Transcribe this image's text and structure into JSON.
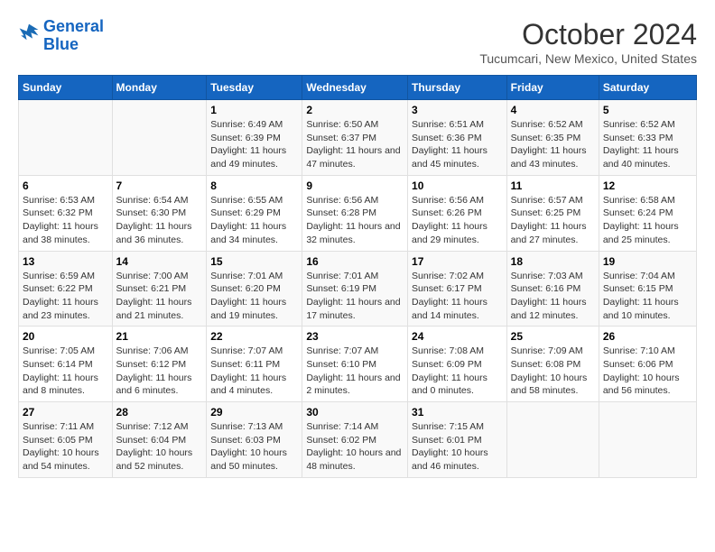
{
  "logo": {
    "line1": "General",
    "line2": "Blue"
  },
  "title": "October 2024",
  "subtitle": "Tucumcari, New Mexico, United States",
  "weekdays": [
    "Sunday",
    "Monday",
    "Tuesday",
    "Wednesday",
    "Thursday",
    "Friday",
    "Saturday"
  ],
  "weeks": [
    [
      {
        "day": "",
        "info": ""
      },
      {
        "day": "",
        "info": ""
      },
      {
        "day": "1",
        "info": "Sunrise: 6:49 AM\nSunset: 6:39 PM\nDaylight: 11 hours and 49 minutes."
      },
      {
        "day": "2",
        "info": "Sunrise: 6:50 AM\nSunset: 6:37 PM\nDaylight: 11 hours and 47 minutes."
      },
      {
        "day": "3",
        "info": "Sunrise: 6:51 AM\nSunset: 6:36 PM\nDaylight: 11 hours and 45 minutes."
      },
      {
        "day": "4",
        "info": "Sunrise: 6:52 AM\nSunset: 6:35 PM\nDaylight: 11 hours and 43 minutes."
      },
      {
        "day": "5",
        "info": "Sunrise: 6:52 AM\nSunset: 6:33 PM\nDaylight: 11 hours and 40 minutes."
      }
    ],
    [
      {
        "day": "6",
        "info": "Sunrise: 6:53 AM\nSunset: 6:32 PM\nDaylight: 11 hours and 38 minutes."
      },
      {
        "day": "7",
        "info": "Sunrise: 6:54 AM\nSunset: 6:30 PM\nDaylight: 11 hours and 36 minutes."
      },
      {
        "day": "8",
        "info": "Sunrise: 6:55 AM\nSunset: 6:29 PM\nDaylight: 11 hours and 34 minutes."
      },
      {
        "day": "9",
        "info": "Sunrise: 6:56 AM\nSunset: 6:28 PM\nDaylight: 11 hours and 32 minutes."
      },
      {
        "day": "10",
        "info": "Sunrise: 6:56 AM\nSunset: 6:26 PM\nDaylight: 11 hours and 29 minutes."
      },
      {
        "day": "11",
        "info": "Sunrise: 6:57 AM\nSunset: 6:25 PM\nDaylight: 11 hours and 27 minutes."
      },
      {
        "day": "12",
        "info": "Sunrise: 6:58 AM\nSunset: 6:24 PM\nDaylight: 11 hours and 25 minutes."
      }
    ],
    [
      {
        "day": "13",
        "info": "Sunrise: 6:59 AM\nSunset: 6:22 PM\nDaylight: 11 hours and 23 minutes."
      },
      {
        "day": "14",
        "info": "Sunrise: 7:00 AM\nSunset: 6:21 PM\nDaylight: 11 hours and 21 minutes."
      },
      {
        "day": "15",
        "info": "Sunrise: 7:01 AM\nSunset: 6:20 PM\nDaylight: 11 hours and 19 minutes."
      },
      {
        "day": "16",
        "info": "Sunrise: 7:01 AM\nSunset: 6:19 PM\nDaylight: 11 hours and 17 minutes."
      },
      {
        "day": "17",
        "info": "Sunrise: 7:02 AM\nSunset: 6:17 PM\nDaylight: 11 hours and 14 minutes."
      },
      {
        "day": "18",
        "info": "Sunrise: 7:03 AM\nSunset: 6:16 PM\nDaylight: 11 hours and 12 minutes."
      },
      {
        "day": "19",
        "info": "Sunrise: 7:04 AM\nSunset: 6:15 PM\nDaylight: 11 hours and 10 minutes."
      }
    ],
    [
      {
        "day": "20",
        "info": "Sunrise: 7:05 AM\nSunset: 6:14 PM\nDaylight: 11 hours and 8 minutes."
      },
      {
        "day": "21",
        "info": "Sunrise: 7:06 AM\nSunset: 6:12 PM\nDaylight: 11 hours and 6 minutes."
      },
      {
        "day": "22",
        "info": "Sunrise: 7:07 AM\nSunset: 6:11 PM\nDaylight: 11 hours and 4 minutes."
      },
      {
        "day": "23",
        "info": "Sunrise: 7:07 AM\nSunset: 6:10 PM\nDaylight: 11 hours and 2 minutes."
      },
      {
        "day": "24",
        "info": "Sunrise: 7:08 AM\nSunset: 6:09 PM\nDaylight: 11 hours and 0 minutes."
      },
      {
        "day": "25",
        "info": "Sunrise: 7:09 AM\nSunset: 6:08 PM\nDaylight: 10 hours and 58 minutes."
      },
      {
        "day": "26",
        "info": "Sunrise: 7:10 AM\nSunset: 6:06 PM\nDaylight: 10 hours and 56 minutes."
      }
    ],
    [
      {
        "day": "27",
        "info": "Sunrise: 7:11 AM\nSunset: 6:05 PM\nDaylight: 10 hours and 54 minutes."
      },
      {
        "day": "28",
        "info": "Sunrise: 7:12 AM\nSunset: 6:04 PM\nDaylight: 10 hours and 52 minutes."
      },
      {
        "day": "29",
        "info": "Sunrise: 7:13 AM\nSunset: 6:03 PM\nDaylight: 10 hours and 50 minutes."
      },
      {
        "day": "30",
        "info": "Sunrise: 7:14 AM\nSunset: 6:02 PM\nDaylight: 10 hours and 48 minutes."
      },
      {
        "day": "31",
        "info": "Sunrise: 7:15 AM\nSunset: 6:01 PM\nDaylight: 10 hours and 46 minutes."
      },
      {
        "day": "",
        "info": ""
      },
      {
        "day": "",
        "info": ""
      }
    ]
  ]
}
